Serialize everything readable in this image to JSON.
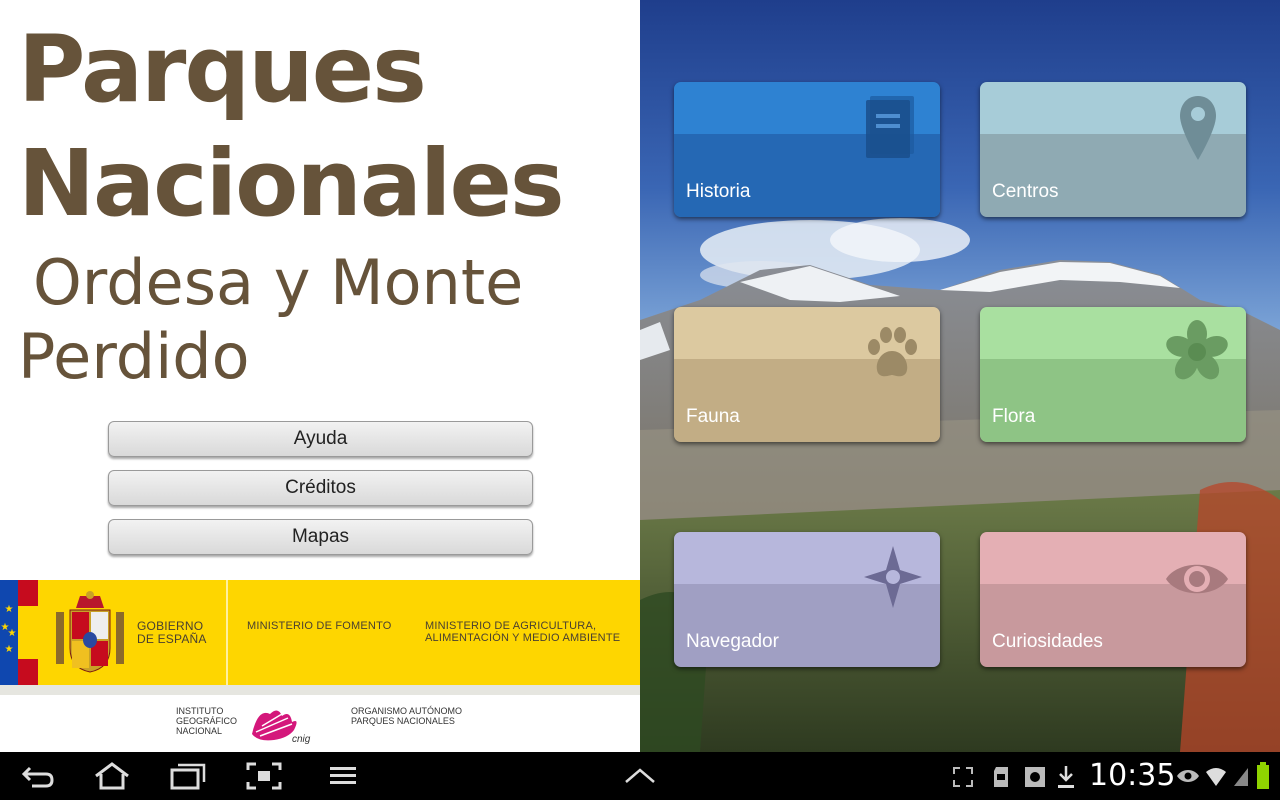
{
  "title": {
    "line1": "Parques",
    "line2": "Nacionales"
  },
  "subtitle": {
    "line1": "Ordesa y Monte",
    "line2": "Perdido"
  },
  "menu": {
    "help": "Ayuda",
    "credits": "Créditos",
    "maps": "Mapas"
  },
  "gov_logos": {
    "gobierno": [
      "GOBIERNO",
      "DE ESPAÑA"
    ],
    "fomento": "MINISTERIO DE FOMENTO",
    "agricultura": [
      "MINISTERIO DE AGRICULTURA,",
      "ALIMENTACIÓN Y MEDIO AMBIENTE"
    ],
    "ign": [
      "INSTITUTO",
      "GEOGRÁFICO",
      "NACIONAL"
    ],
    "cnig": "cnig",
    "oapn": [
      "ORGANISMO AUTÓNOMO",
      "PARQUES NACIONALES"
    ]
  },
  "tiles": [
    {
      "label": "Historia",
      "icon": "book-icon",
      "color_top": "#2e82d2",
      "color_bottom": "#2568b4"
    },
    {
      "label": "Centros",
      "icon": "location-pin-icon",
      "color_top": "#a7ccd8",
      "color_bottom": "#8faab3"
    },
    {
      "label": "Fauna",
      "icon": "paw-icon",
      "color_top": "#dcc9a0",
      "color_bottom": "#c2ad85"
    },
    {
      "label": "Flora",
      "icon": "flower-icon",
      "color_top": "#a9e0a0",
      "color_bottom": "#8ec485"
    },
    {
      "label": "Navegador",
      "icon": "compass-icon",
      "color_top": "#b7b7dc",
      "color_bottom": "#a09fc3"
    },
    {
      "label": "Curiosidades",
      "icon": "eye-icon",
      "color_top": "#e4afb4",
      "color_bottom": "#c8999d"
    }
  ],
  "status_bar": {
    "time": "10:35"
  },
  "colors": {
    "title": "#66533a",
    "gov_yellow": "#fed600",
    "spain_red": "#c60b1e",
    "eu_blue": "#003399"
  }
}
